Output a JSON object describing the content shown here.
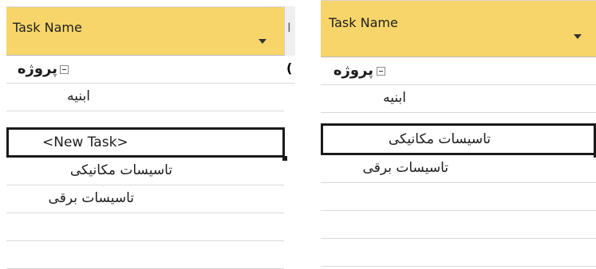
{
  "left_pane": {
    "header": {
      "title": "Task Name",
      "next_col_fragment": "I"
    },
    "rows": [
      {
        "label": "پروژه",
        "is_summary": true
      },
      {
        "label": "ابنیه",
        "is_summary": false
      },
      {
        "label": "<New Task>",
        "is_summary": false,
        "selected": true
      },
      {
        "label": "تاسیسات مکانیکی",
        "is_summary": false
      },
      {
        "label": "تاسیسات برقی",
        "is_summary": false
      },
      {
        "label": "",
        "is_summary": false
      },
      {
        "label": "",
        "is_summary": false
      }
    ],
    "summary_next_col_fragment": "("
  },
  "right_pane": {
    "header": {
      "title": "Task Name"
    },
    "rows": [
      {
        "label": "پروژه",
        "is_summary": true
      },
      {
        "label": "ابنیه",
        "is_summary": false
      },
      {
        "label": "تاسیسات مکانیکی",
        "is_summary": false,
        "selected": true
      },
      {
        "label": "تاسیسات برقی",
        "is_summary": false
      },
      {
        "label": "",
        "is_summary": false
      },
      {
        "label": "",
        "is_summary": false
      },
      {
        "label": "",
        "is_summary": false
      }
    ]
  },
  "colors": {
    "header_bg": "#f7d56a",
    "selection_border": "#1a1a1a",
    "gridline": "#d9d9d9"
  },
  "icons": [
    "dropdown-arrow-icon",
    "collapse-minus-icon"
  ]
}
